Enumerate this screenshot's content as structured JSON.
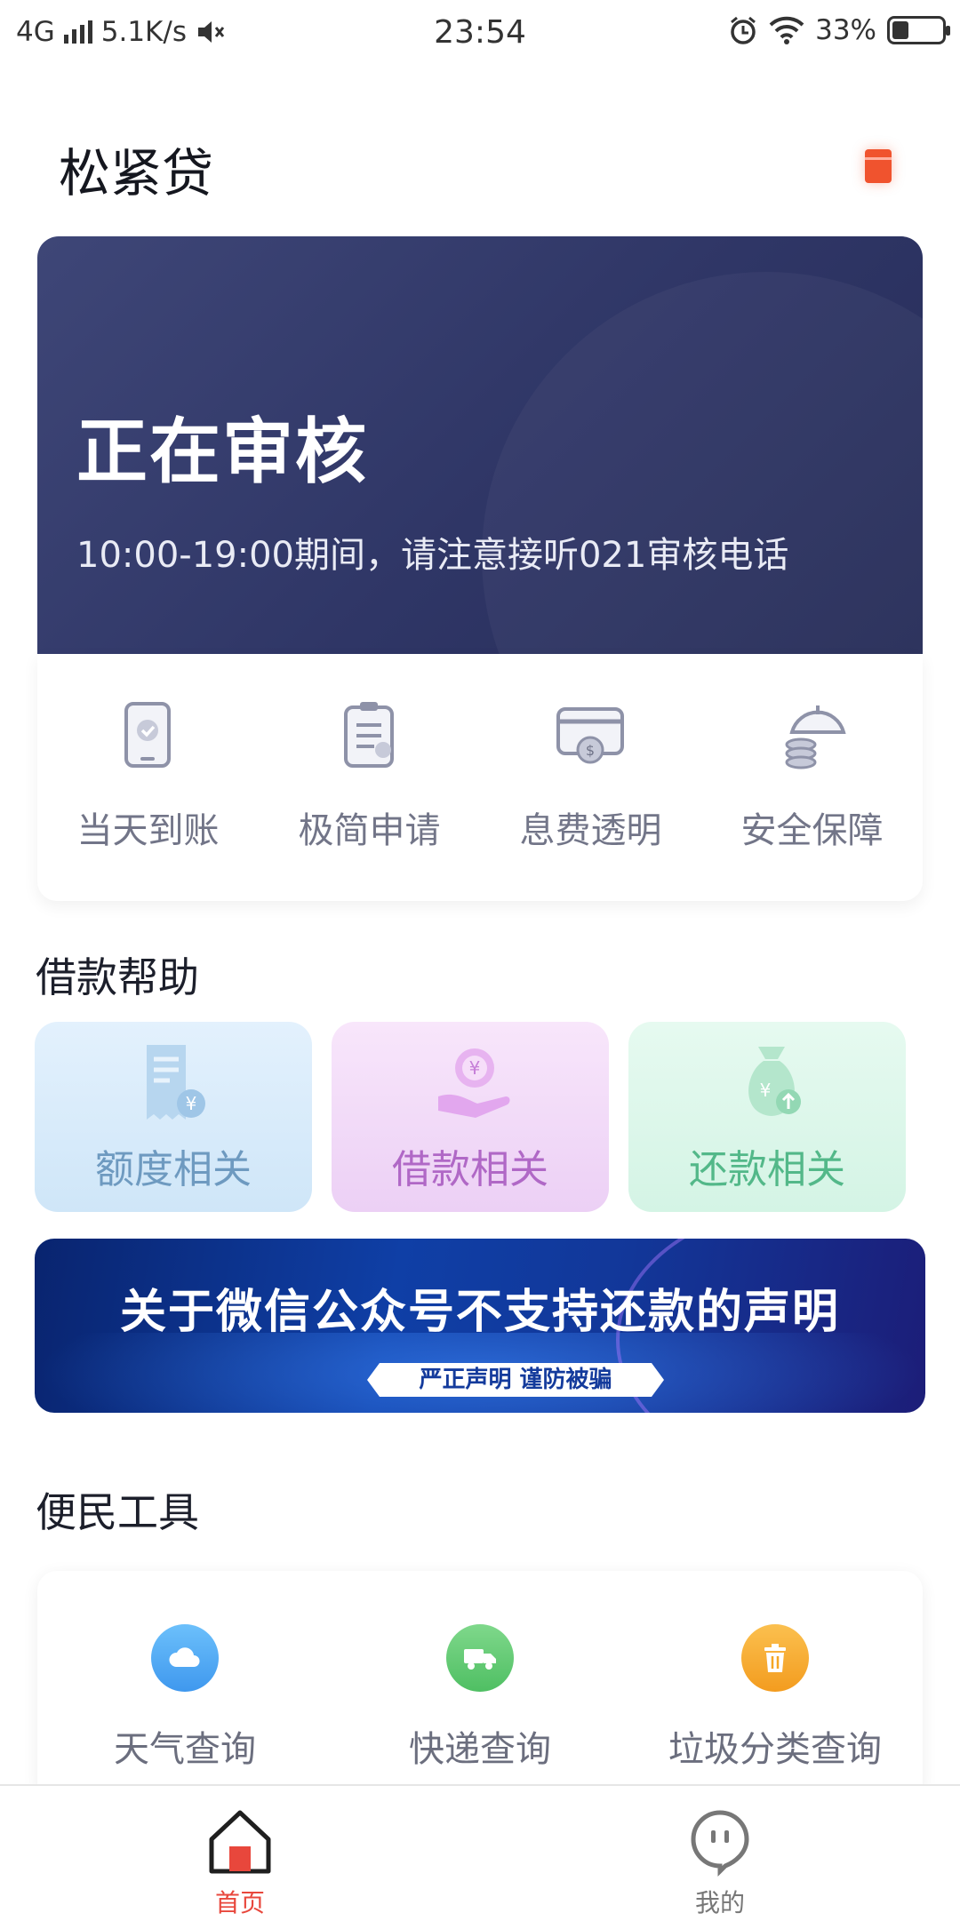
{
  "status_bar": {
    "network": "4G",
    "speed": "5.1K/s",
    "time": "23:54",
    "battery": "33%"
  },
  "header": {
    "title": "松紧贷",
    "gift_icon": "red-envelope-icon"
  },
  "review_card": {
    "title": "正在审核",
    "subtitle": "10:00-19:00期间，请注意接听021审核电话"
  },
  "features": [
    {
      "label": "当天到账",
      "icon": "phone-check-icon"
    },
    {
      "label": "极简申请",
      "icon": "clipboard-icon"
    },
    {
      "label": "息费透明",
      "icon": "card-dollar-icon"
    },
    {
      "label": "安全保障",
      "icon": "umbrella-coins-icon"
    }
  ],
  "loan_help": {
    "title": "借款帮助",
    "cards": [
      {
        "label": "额度相关",
        "icon": "receipt-yen-icon",
        "color": "#6e9ac0"
      },
      {
        "label": "借款相关",
        "icon": "hand-yen-icon",
        "color": "#b068c6"
      },
      {
        "label": "还款相关",
        "icon": "money-bag-icon",
        "color": "#53b889"
      }
    ]
  },
  "banner": {
    "title": "关于微信公众号不支持还款的声明",
    "tag": "严正声明 谨防被骗"
  },
  "tools": {
    "title": "便民工具",
    "items": [
      {
        "label": "天气查询",
        "icon": "cloud-icon",
        "color": "#4fa8f5"
      },
      {
        "label": "快递查询",
        "icon": "truck-icon",
        "color": "#5cc76e"
      },
      {
        "label": "垃圾分类查询",
        "icon": "trash-icon",
        "color": "#f5a623"
      }
    ]
  },
  "bottom_nav": {
    "items": [
      {
        "label": "首页",
        "icon": "home-icon",
        "active": true,
        "color": "#e8473c"
      },
      {
        "label": "我的",
        "icon": "profile-face-icon",
        "active": false,
        "color": "#777777"
      }
    ]
  }
}
